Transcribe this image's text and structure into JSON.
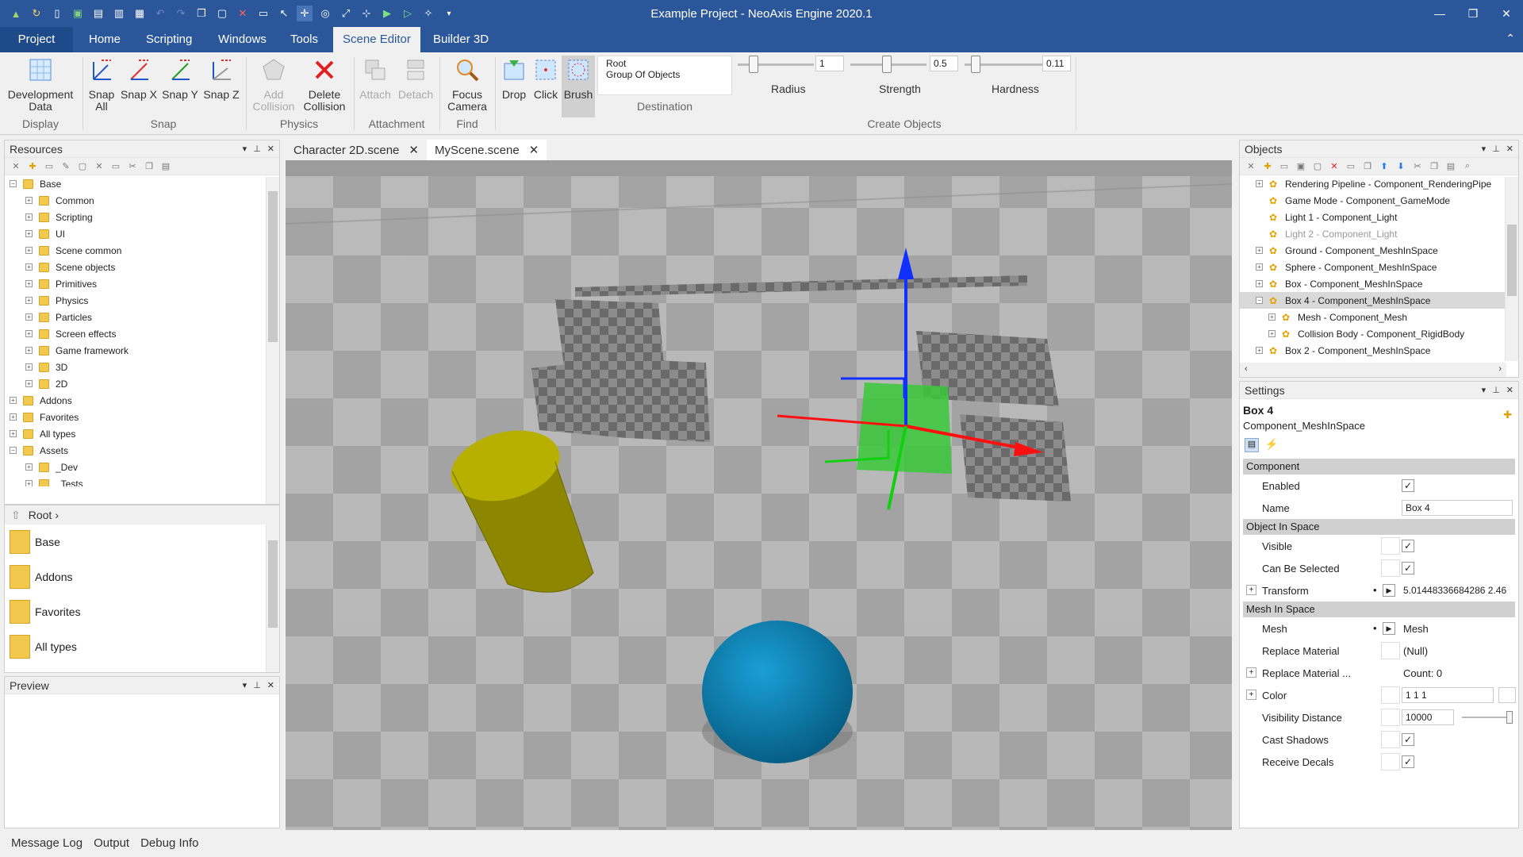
{
  "window": {
    "title": "Example Project - NeoAxis Engine 2020.1"
  },
  "menu_tabs": [
    "Project",
    "Home",
    "Scripting",
    "Windows",
    "Tools",
    "Scene Editor",
    "Builder 3D"
  ],
  "ribbon": {
    "buttons": {
      "dev_data": "Development Data",
      "snap_all": "Snap All",
      "snap_x": "Snap X",
      "snap_y": "Snap Y",
      "snap_z": "Snap Z",
      "add_collision": "Add Collision",
      "delete_collision": "Delete Collision",
      "attach": "Attach",
      "detach": "Detach",
      "focus_camera": "Focus Camera",
      "drop": "Drop",
      "click": "Click",
      "brush": "Brush"
    },
    "groups": {
      "display": "Display",
      "snap": "Snap",
      "physics": "Physics",
      "attachment": "Attachment",
      "find": "Find",
      "destination": "Destination",
      "create_objects": "Create Objects"
    },
    "destination": [
      "Root",
      "Group Of Objects"
    ],
    "radius": {
      "label": "Radius",
      "value": "1"
    },
    "strength": {
      "label": "Strength",
      "value": "0.5"
    },
    "hardness": {
      "label": "Hardness",
      "value": "0.11"
    }
  },
  "resources": {
    "title": "Resources",
    "tree": [
      {
        "label": "Base",
        "level": 0,
        "expanded": true
      },
      {
        "label": "Common",
        "level": 1
      },
      {
        "label": "Scripting",
        "level": 1
      },
      {
        "label": "UI",
        "level": 1
      },
      {
        "label": "Scene common",
        "level": 1
      },
      {
        "label": "Scene objects",
        "level": 1
      },
      {
        "label": "Primitives",
        "level": 1
      },
      {
        "label": "Physics",
        "level": 1
      },
      {
        "label": "Particles",
        "level": 1
      },
      {
        "label": "Screen effects",
        "level": 1
      },
      {
        "label": "Game framework",
        "level": 1
      },
      {
        "label": "3D",
        "level": 1
      },
      {
        "label": "2D",
        "level": 1
      },
      {
        "label": "Addons",
        "level": 0
      },
      {
        "label": "Favorites",
        "level": 0
      },
      {
        "label": "All types",
        "level": 0
      },
      {
        "label": "Assets",
        "level": 0,
        "expanded": true
      },
      {
        "label": "_Dev",
        "level": 1
      },
      {
        "label": "_Tests",
        "level": 1
      }
    ],
    "breadcrumb": "Root",
    "list": [
      "Base",
      "Addons",
      "Favorites",
      "All types"
    ]
  },
  "preview": {
    "title": "Preview"
  },
  "documents": {
    "tabs": [
      "Character 2D.scene",
      "MyScene.scene"
    ]
  },
  "objects": {
    "title": "Objects",
    "tree": [
      {
        "label": "Rendering Pipeline - Component_RenderingPipe",
        "level": 0,
        "exp": "+"
      },
      {
        "label": "Game Mode - Component_GameMode",
        "level": 0,
        "exp": ""
      },
      {
        "label": "Light 1 - Component_Light",
        "level": 0,
        "exp": ""
      },
      {
        "label": "Light 2 - Component_Light",
        "level": 0,
        "exp": "",
        "dim": true
      },
      {
        "label": "Ground - Component_MeshInSpace",
        "level": 0,
        "exp": "+"
      },
      {
        "label": "Sphere - Component_MeshInSpace",
        "level": 0,
        "exp": "+"
      },
      {
        "label": "Box - Component_MeshInSpace",
        "level": 0,
        "exp": "+"
      },
      {
        "label": "Box 4 - Component_MeshInSpace",
        "level": 0,
        "exp": "−",
        "selected": true
      },
      {
        "label": "Mesh - Component_Mesh",
        "level": 1,
        "exp": "+"
      },
      {
        "label": "Collision Body - Component_RigidBody",
        "level": 1,
        "exp": "+"
      },
      {
        "label": "Box 2 - Component_MeshInSpace",
        "level": 0,
        "exp": "+"
      }
    ]
  },
  "settings": {
    "title": "Settings",
    "object_name": "Box 4",
    "object_type": "Component_MeshInSpace",
    "sections": {
      "component": "Component",
      "object_in_space": "Object In Space",
      "mesh_in_space": "Mesh In Space"
    },
    "props": {
      "enabled": "Enabled",
      "name": "Name",
      "name_value": "Box 4",
      "visible": "Visible",
      "can_be_selected": "Can Be Selected",
      "transform": "Transform",
      "transform_value": "5.01448336684286 2.46",
      "mesh": "Mesh",
      "mesh_value": "Mesh",
      "replace_material": "Replace Material",
      "replace_material_value": "(Null)",
      "replace_material_sel": "Replace Material ...",
      "replace_material_sel_value": "Count: 0",
      "color": "Color",
      "color_value": "1 1 1",
      "visibility_distance": "Visibility Distance",
      "visibility_distance_value": "10000",
      "cast_shadows": "Cast Shadows",
      "receive_decals": "Receive Decals"
    }
  },
  "bottom_tabs": [
    "Message Log",
    "Output",
    "Debug Info"
  ],
  "colors": {
    "accent": "#2b579a",
    "selection": "#d9d9d9",
    "cylinder": "#a8a000",
    "sphere": "#0a7fb0",
    "green_box": "#38c838"
  }
}
